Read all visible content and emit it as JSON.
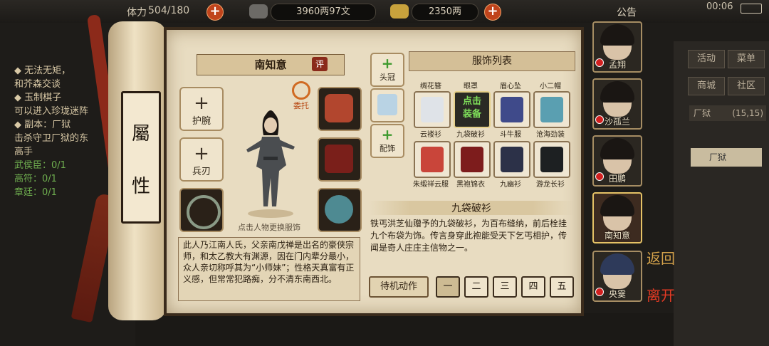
{
  "topbar": {
    "stamina_label": "体力",
    "stamina_value": "504/180",
    "copper_value": "3960两97文",
    "silver_value": "2350两",
    "announcement": "公告",
    "clock": "00:06"
  },
  "left_info": {
    "lines": [
      {
        "text": "◆ 无法无矩，",
        "style": "w"
      },
      {
        "text": "和芥森交谈",
        "style": "w"
      },
      {
        "text": "◆ 玉制棋子",
        "style": "w"
      },
      {
        "text": "可以进入珍珑迷阵",
        "style": "w"
      },
      {
        "text": "◆ 副本：厂狱",
        "style": "w"
      },
      {
        "text": "击杀守卫厂狱的东",
        "style": "w"
      },
      {
        "text": "高手",
        "style": "w"
      },
      {
        "text": "武侯臣：0/1",
        "style": "g"
      },
      {
        "text": "高符：0/1",
        "style": "g"
      },
      {
        "text": "章廷：0/1",
        "style": "g"
      }
    ]
  },
  "scroll": {
    "char1": "屬",
    "char2": "性"
  },
  "character": {
    "name": "南知意",
    "rate_label": "评",
    "delegate_label": "委托",
    "change_hint": "点击人物更换服饰",
    "description": "此人乃江南人氏，父亲南戊禅是出名的豪侠宗师，和太乙教大有渊源，因在门内辈分最小，众人亲切称呼其为“小师妹”；性格天真富有正义感，但常常犯路痴，分不清东南西北。"
  },
  "equip_slots": {
    "wrist": "护腕",
    "weapon": "兵刃",
    "headwear": "头冠",
    "accessory": "配饰"
  },
  "costume_list": {
    "title": "服饰列表",
    "top_row": [
      "绸花簪",
      "眼罩",
      "眉心坠",
      "小二帽"
    ],
    "row1": [
      "云褛衫",
      "九袋破衫",
      "斗牛服",
      "沧海劲装"
    ],
    "row2": [
      "朱缎祥云服",
      "黑袍锦衣",
      "九幽衫",
      "游龙长衫"
    ],
    "equip_label_1": "点击",
    "equip_label_2": "装备",
    "selected_name": "九袋破衫",
    "selected_desc": "铁丐洪芝仙赠予的九袋破衫，为百布缝纳，前后栓挂九个布袋为饰。传言身穿此袍能受天下乞丐相护，传闻是奇人庄庄主信物之一。"
  },
  "idle": {
    "label": "待机动作",
    "options": [
      "一",
      "二",
      "三",
      "四",
      "五"
    ],
    "selected": 0
  },
  "roster": [
    {
      "name": "孟翔"
    },
    {
      "name": "沙孤兰"
    },
    {
      "name": "田鹏"
    },
    {
      "name": "南知意"
    },
    {
      "name": "央霙"
    }
  ],
  "right_menu": {
    "activity": "活动",
    "menu": "菜单",
    "shop": "商城",
    "community": "社区",
    "location": "厂狱",
    "coords": "(15,15)",
    "quest": "厂狱"
  },
  "nav": {
    "back": "返回",
    "leave": "离开"
  },
  "colors": {
    "accent_red": "#c0441c",
    "parchment": "#e8dcc1",
    "ink": "#2d1f10",
    "equip_green": "#7fe05a"
  }
}
